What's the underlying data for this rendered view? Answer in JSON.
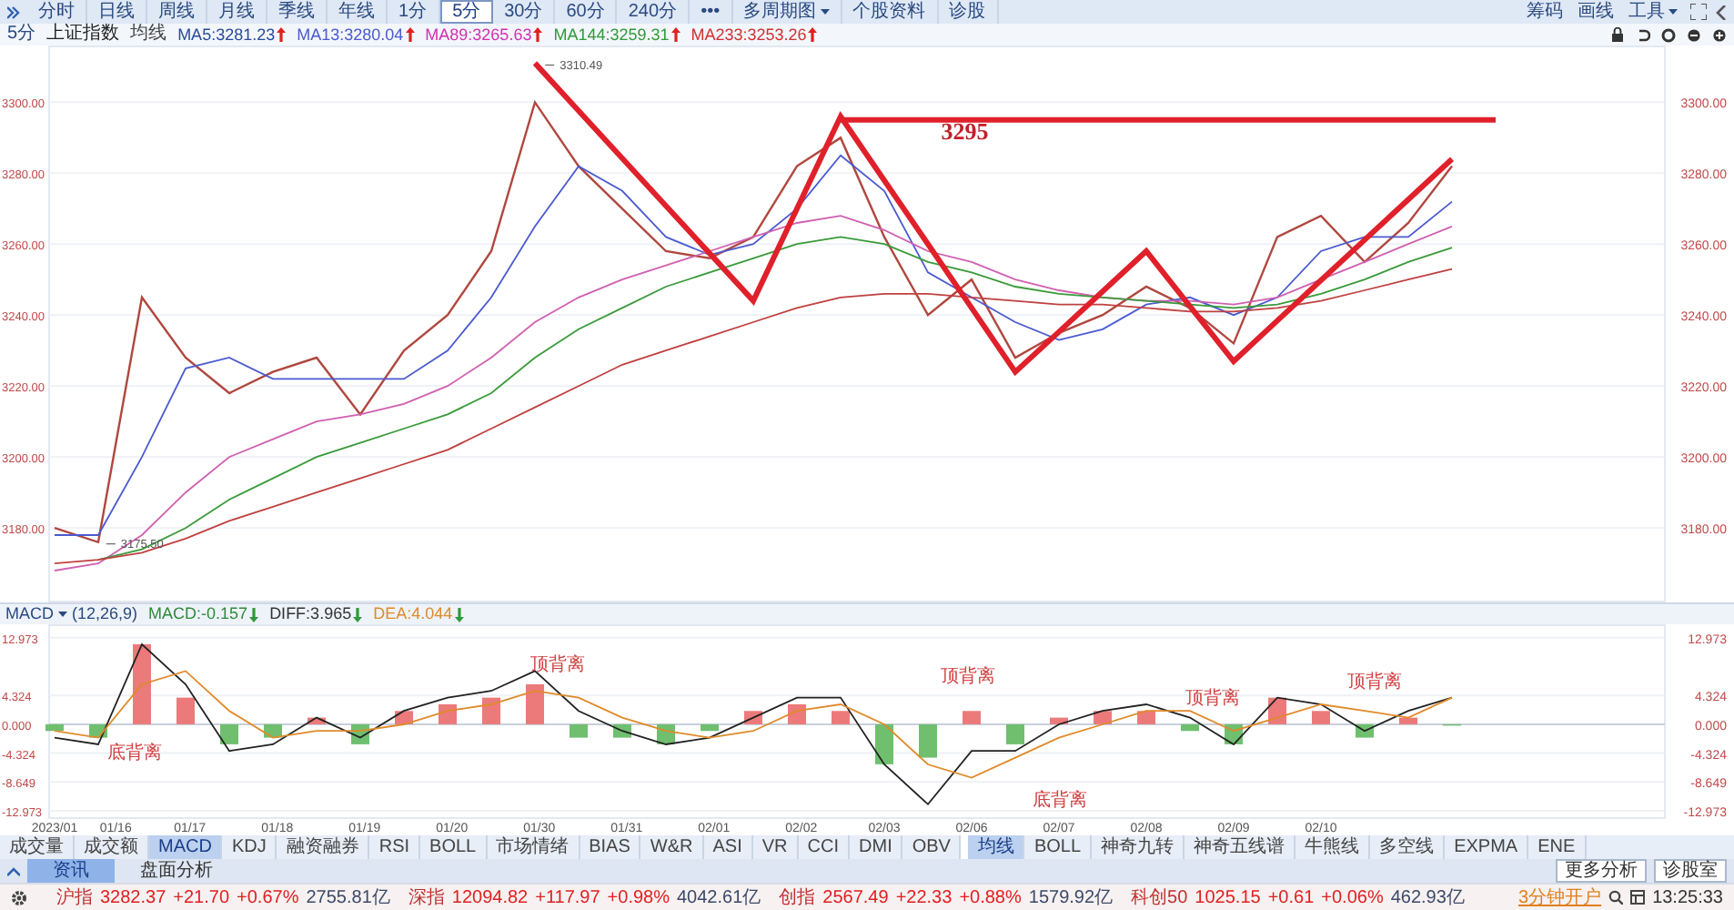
{
  "toolbar": {
    "tabs": [
      {
        "label": "分时",
        "selected": false
      },
      {
        "label": "日线",
        "selected": false
      },
      {
        "label": "周线",
        "selected": false
      },
      {
        "label": "月线",
        "selected": false
      },
      {
        "label": "季线",
        "selected": false
      },
      {
        "label": "年线",
        "selected": false
      },
      {
        "label": "1分",
        "selected": false
      },
      {
        "label": "5分",
        "selected": true
      },
      {
        "label": "30分",
        "selected": false
      },
      {
        "label": "60分",
        "selected": false
      },
      {
        "label": "240分",
        "selected": false
      },
      {
        "label": "•••",
        "selected": false
      }
    ],
    "menus": [
      {
        "label": "多周期图",
        "dropdown": true
      },
      {
        "label": "个股资料",
        "dropdown": false
      },
      {
        "label": "诊股",
        "dropdown": false
      }
    ],
    "right": [
      {
        "label": "筹码",
        "dropdown": false
      },
      {
        "label": "画线",
        "dropdown": false
      },
      {
        "label": "工具",
        "dropdown": true
      }
    ]
  },
  "legend": {
    "period": "5分",
    "index": "上证指数",
    "ma_label": "均线",
    "items": [
      {
        "text": "MA5:3281.23",
        "rising": true,
        "color": "#2a4a9a"
      },
      {
        "text": "MA13:3280.04",
        "rising": true,
        "color": "#4a5ad0"
      },
      {
        "text": "MA89:3265.63",
        "rising": true,
        "color": "#d030b0"
      },
      {
        "text": "MA144:3259.31",
        "rising": true,
        "color": "#2f9a3a"
      },
      {
        "text": "MA233:3253.26",
        "rising": true,
        "color": "#d03030"
      }
    ]
  },
  "price_chart": {
    "chart_data": {
      "type": "line",
      "grid": true,
      "ylim": [
        3159,
        3316
      ],
      "yticks": [
        {
          "value": 3180,
          "label": "3180.00"
        },
        {
          "value": 3200,
          "label": "3200.00"
        },
        {
          "value": 3220,
          "label": "3220.00"
        },
        {
          "value": 3240,
          "label": "3240.00"
        },
        {
          "value": 3260,
          "label": "3260.00"
        },
        {
          "value": 3280,
          "label": "3280.00"
        },
        {
          "value": 3300,
          "label": "3300.00"
        }
      ],
      "series": [
        {
          "color": "#b0473f",
          "values": [
            3180,
            3176,
            3245,
            3228,
            3218,
            3224,
            3228,
            3212,
            3230,
            3240,
            3258,
            3300,
            3282,
            3270,
            3258,
            3256,
            3262,
            3282,
            3290,
            3262,
            3240,
            3250,
            3228,
            3235,
            3240,
            3248,
            3242,
            3232,
            3262,
            3268,
            3255,
            3266,
            3282,
            null
          ]
        },
        {
          "color": "#4a5ad0",
          "values": [
            3178,
            3178,
            3200,
            3225,
            3228,
            3222,
            3222,
            3222,
            3222,
            3230,
            3245,
            3265,
            3282,
            3275,
            3262,
            3257,
            3260,
            3270,
            3285,
            3275,
            3252,
            3245,
            3238,
            3233,
            3236,
            3243,
            3245,
            3240,
            3245,
            3258,
            3262,
            3262,
            3272,
            null
          ]
        },
        {
          "color": "#d060b0",
          "values": [
            3168,
            3170,
            3178,
            3190,
            3200,
            3205,
            3210,
            3212,
            3215,
            3220,
            3228,
            3238,
            3245,
            3250,
            3254,
            3258,
            3262,
            3266,
            3268,
            3264,
            3258,
            3255,
            3250,
            3247,
            3245,
            3244,
            3244,
            3243,
            3245,
            3250,
            3255,
            3260,
            3265,
            null
          ]
        },
        {
          "color": "#3a9a3a",
          "values": [
            null,
            3171,
            3174,
            3180,
            3188,
            3194,
            3200,
            3204,
            3208,
            3212,
            3218,
            3228,
            3236,
            3242,
            3248,
            3252,
            3256,
            3260,
            3262,
            3260,
            3255,
            3252,
            3248,
            3246,
            3245,
            3244,
            3243,
            3242,
            3243,
            3246,
            3250,
            3255,
            3259,
            null
          ]
        },
        {
          "color": "#c04040",
          "values": [
            3170,
            3171,
            3173,
            3177,
            3182,
            3186,
            3190,
            3194,
            3198,
            3202,
            3208,
            3214,
            3220,
            3226,
            3230,
            3234,
            3238,
            3242,
            3245,
            3246,
            3246,
            3245,
            3244,
            3243,
            3243,
            3242,
            3241,
            3241,
            3242,
            3244,
            3247,
            3250,
            3253,
            null
          ]
        },
        {
          "color": "#e0202a",
          "values": [
            null,
            null,
            null,
            null,
            null,
            null,
            null,
            null,
            null,
            null,
            null,
            3311,
            3297.6,
            3284.2,
            3270.8,
            3257.4,
            3244,
            3270,
            3296,
            3278,
            3260,
            3242,
            3224,
            3235.3,
            3246.7,
            3258,
            3242.5,
            3227,
            3238.4,
            3249.8,
            3261.2,
            3272.6,
            3284,
            null
          ]
        },
        {
          "color": "#e0202b",
          "values": [
            null,
            null,
            null,
            null,
            null,
            null,
            null,
            null,
            null,
            null,
            null,
            null,
            null,
            null,
            null,
            null,
            null,
            null,
            3295,
            3295,
            3295,
            3295,
            3295,
            3295,
            3295,
            3295,
            3295,
            3295,
            3295,
            3295,
            3295,
            3295,
            3295,
            3295
          ]
        }
      ]
    }
  },
  "price_marks": [
    {
      "text": "3310.49"
    },
    {
      "text": "3175.50"
    },
    {
      "text": "3295"
    }
  ],
  "macd_header": {
    "name": "MACD",
    "params": "(12,26,9)",
    "values": [
      {
        "text": "MACD:-0.157",
        "rising": false,
        "color": "#2f8a3a"
      },
      {
        "text": "DIFF:3.965",
        "rising": false,
        "color": "#333333"
      },
      {
        "text": "DEA:4.044",
        "rising": false,
        "color": "#e08a2a"
      }
    ]
  },
  "macd_chart": {
    "chart_data": {
      "type": "bar",
      "grid": true,
      "ylim": [
        -14.2,
        15.0
      ],
      "yticks": [
        {
          "value": 12.973,
          "label": "12.973"
        },
        {
          "value": 4.324,
          "label": "4.324"
        },
        {
          "value": 0,
          "label": "0.000"
        },
        {
          "value": -4.324,
          "label": "-4.324"
        },
        {
          "value": -8.649,
          "label": "-8.649"
        },
        {
          "value": -12.973,
          "label": "-12.973"
        }
      ],
      "series": [
        {
          "colors": [
            "#6fbf6f",
            "#6fbf6f",
            "#ec7a7a",
            "#ec7a7a",
            "#6fbf6f",
            "#6fbf6f",
            "#ec7a7a",
            "#6fbf6f",
            "#ec7a7a",
            "#ec7a7a",
            "#ec7a7a",
            "#ec7a7a",
            "#6fbf6f",
            "#6fbf6f",
            "#6fbf6f",
            "#6fbf6f",
            "#ec7a7a",
            "#ec7a7a",
            "#ec7a7a",
            "#6fbf6f",
            "#6fbf6f",
            "#ec7a7a",
            "#6fbf6f",
            "#ec7a7a",
            "#ec7a7a",
            "#ec7a7a",
            "#6fbf6f",
            "#6fbf6f",
            "#ec7a7a",
            "#ec7a7a",
            "#6fbf6f",
            "#ec7a7a",
            "#6fbf6f"
          ],
          "values": [
            -1,
            -2,
            12,
            4,
            -3,
            -2,
            1,
            -3,
            2,
            3,
            4,
            6,
            -2,
            -2,
            -3,
            -1,
            2,
            3,
            2,
            -6,
            -5,
            2,
            -3,
            1,
            2,
            2,
            -1,
            -3,
            4,
            2,
            -2,
            1,
            -0.2
          ]
        },
        {
          "type": "line",
          "color": "#222222",
          "values": [
            -2,
            -3,
            12,
            6,
            -4,
            -3,
            1,
            -2,
            2,
            4,
            5,
            8,
            2,
            -1,
            -3,
            -2,
            1,
            4,
            4,
            -6,
            -12,
            -4,
            -4,
            0,
            2,
            3,
            1,
            -3,
            4,
            3,
            -1,
            2,
            4
          ]
        },
        {
          "type": "line",
          "color": "#e08a2a",
          "values": [
            -1,
            -2,
            6,
            8,
            2,
            -2,
            -1,
            -1,
            0,
            2,
            3,
            5,
            4,
            1,
            -1,
            -2,
            -1,
            2,
            3,
            0,
            -6,
            -8,
            -5,
            -2,
            0,
            2,
            2,
            -1,
            1,
            3,
            2,
            1,
            4
          ]
        }
      ]
    }
  },
  "signal_labels": [
    {
      "text": "底背离"
    },
    {
      "text": "顶背离"
    },
    {
      "text": "顶背离"
    },
    {
      "text": "底背离"
    },
    {
      "text": "顶背离"
    },
    {
      "text": "顶背离"
    }
  ],
  "date_axis": [
    {
      "label": "2023/01"
    },
    {
      "label": "01/16"
    },
    {
      "label": "01/17"
    },
    {
      "label": "01/18"
    },
    {
      "label": "01/19"
    },
    {
      "label": "01/20"
    },
    {
      "label": "01/30"
    },
    {
      "label": "01/31"
    },
    {
      "label": "02/01"
    },
    {
      "label": "02/02"
    },
    {
      "label": "02/03"
    },
    {
      "label": "02/06"
    },
    {
      "label": "02/07"
    },
    {
      "label": "02/08"
    },
    {
      "label": "02/09"
    },
    {
      "label": "02/10"
    }
  ],
  "indicator_tabs": [
    [
      {
        "label": "成交量",
        "selected": false
      },
      {
        "label": "成交额",
        "selected": false
      },
      {
        "label": "MACD",
        "selected": true
      },
      {
        "label": "KDJ",
        "selected": false
      },
      {
        "label": "融资融券",
        "selected": false
      },
      {
        "label": "RSI",
        "selected": false
      },
      {
        "label": "BOLL",
        "selected": false
      },
      {
        "label": "市场情绪",
        "selected": false
      },
      {
        "label": "BIAS",
        "selected": false
      },
      {
        "label": "W&R",
        "selected": false
      },
      {
        "label": "ASI",
        "selected": false
      },
      {
        "label": "VR",
        "selected": false
      },
      {
        "label": "CCI",
        "selected": false
      },
      {
        "label": "DMI",
        "selected": false
      },
      {
        "label": "OBV",
        "selected": false
      }
    ],
    [
      {
        "label": "均线",
        "selected": true
      },
      {
        "label": "BOLL",
        "selected": false
      },
      {
        "label": "神奇九转",
        "selected": false
      },
      {
        "label": "神奇五线谱",
        "selected": false
      },
      {
        "label": "牛熊线",
        "selected": false
      },
      {
        "label": "多空线",
        "selected": false
      },
      {
        "label": "EXPMA",
        "selected": false
      },
      {
        "label": "ENE",
        "selected": false
      }
    ]
  ],
  "info_tabs": [
    {
      "label": "资讯",
      "selected": true
    },
    {
      "label": "盘面分析",
      "selected": false
    }
  ],
  "info_buttons": [
    "更多分析",
    "诊股室"
  ],
  "status_bar": {
    "indices": [
      {
        "name": "沪指",
        "price": "3282.37",
        "change": "+21.70",
        "percent": "+0.67%",
        "volume": "2755.81亿",
        "rising": true
      },
      {
        "name": "深指",
        "price": "12094.82",
        "change": "+117.97",
        "percent": "+0.98%",
        "volume": "4042.61亿",
        "rising": true
      },
      {
        "name": "创指",
        "price": "2567.49",
        "change": "+22.33",
        "percent": "+0.88%",
        "volume": "1579.92亿",
        "rising": true
      },
      {
        "name": "科创50",
        "price": "1025.15",
        "change": "+0.61",
        "percent": "+0.06%",
        "volume": "462.93亿",
        "rising": true
      }
    ],
    "link": "3分钟开户",
    "time": "13:25:33"
  }
}
